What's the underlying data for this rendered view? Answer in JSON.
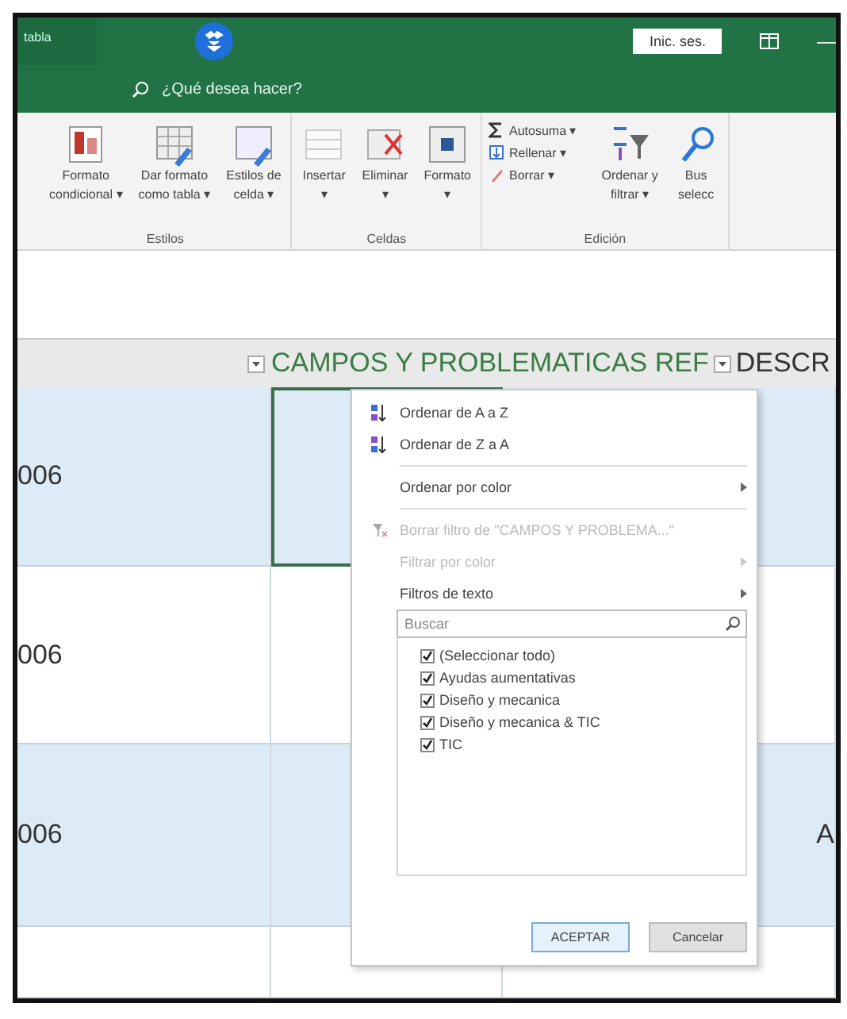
{
  "titlebar": {
    "left_text": "tabla",
    "signin": "Inic. ses.",
    "minimize": "—",
    "tell_me": "¿Qué desea hacer?"
  },
  "ribbon": {
    "groups": [
      {
        "label": "Estilos",
        "commands": [
          {
            "label": "Formato\ncondicional ▾"
          },
          {
            "label": "Dar formato\ncomo tabla ▾"
          },
          {
            "label": "Estilos de\ncelda ▾"
          }
        ]
      },
      {
        "label": "Celdas",
        "commands": [
          {
            "label": "Insertar\n▾"
          },
          {
            "label": "Eliminar\n▾"
          },
          {
            "label": "Formato\n▾"
          }
        ]
      },
      {
        "label": "Edición",
        "small": [
          {
            "label": "Autosuma ▾"
          },
          {
            "label": "Rellenar ▾"
          },
          {
            "label": "Borrar ▾"
          }
        ],
        "commands": [
          {
            "label": "Ordenar y\nfiltrar ▾"
          },
          {
            "label": "Bus\nselecc"
          }
        ]
      }
    ]
  },
  "sheet": {
    "header": "CAMPOS Y PROBLEMATICAS REF",
    "header_next": "DESCR",
    "rows": [
      {
        "col_1": "006",
        "col_3": "",
        "banded": true
      },
      {
        "col_1": "006",
        "col_3": "",
        "banded": false
      },
      {
        "col_1": "006",
        "col_3": "A",
        "banded": true
      },
      {
        "col_1": "",
        "col_3": "",
        "banded": false
      }
    ]
  },
  "filter_menu": {
    "items": [
      {
        "kind": "command",
        "label": "Ordenar de A a Z",
        "disabled": false,
        "submenu": false
      },
      {
        "kind": "command",
        "label": "Ordenar de Z a A",
        "disabled": false,
        "submenu": false
      },
      {
        "kind": "command",
        "label": "Ordenar por color",
        "disabled": false,
        "submenu": true
      },
      {
        "kind": "command",
        "label": "Borrar filtro de \"CAMPOS Y PROBLEMA...\"",
        "disabled": true,
        "submenu": false
      },
      {
        "kind": "command",
        "label": "Filtrar por color",
        "disabled": true,
        "submenu": true
      },
      {
        "kind": "command",
        "label": "Filtros de texto",
        "disabled": false,
        "submenu": true
      }
    ],
    "search_placeholder": "Buscar",
    "values": [
      {
        "label": "(Seleccionar todo)",
        "checked": true
      },
      {
        "label": "Ayudas aumentativas",
        "checked": true
      },
      {
        "label": "Diseño y mecanica",
        "checked": true
      },
      {
        "label": "Diseño y mecanica & TIC",
        "checked": true
      },
      {
        "label": "TIC",
        "checked": true
      }
    ],
    "buttons": [
      {
        "label": "ACEPTAR",
        "default": true
      },
      {
        "label": "Cancelar",
        "default": false
      }
    ]
  }
}
